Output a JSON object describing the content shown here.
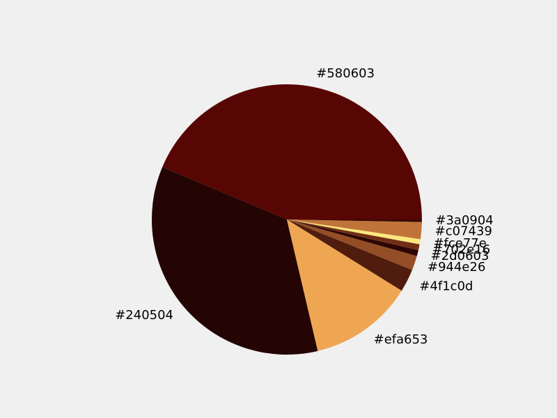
{
  "chart_data": {
    "type": "pie",
    "slices": [
      {
        "label": "#580603",
        "color": "#580603",
        "value": 43.0
      },
      {
        "label": "#240504",
        "color": "#240504",
        "value": 34.5
      },
      {
        "label": "#efa653",
        "color": "#efa653",
        "value": 12.3
      },
      {
        "label": "#4f1c0d",
        "color": "#4f1c0d",
        "value": 2.7
      },
      {
        "label": "#944e26",
        "color": "#944e26",
        "value": 1.7
      },
      {
        "label": "#2d0603",
        "color": "#2d0603",
        "value": 0.7
      },
      {
        "label": "#702e16",
        "color": "#702e16",
        "value": 0.7
      },
      {
        "label": "#fce77e",
        "color": "#fce77e",
        "value": 0.6
      },
      {
        "label": "#c07439",
        "color": "#c07439",
        "value": 2.0
      },
      {
        "label": "#3a0904",
        "color": "#3a0904",
        "value": 0.3
      }
    ],
    "start_angle_deg": 0,
    "direction": "counterclockwise",
    "legend": "none"
  }
}
